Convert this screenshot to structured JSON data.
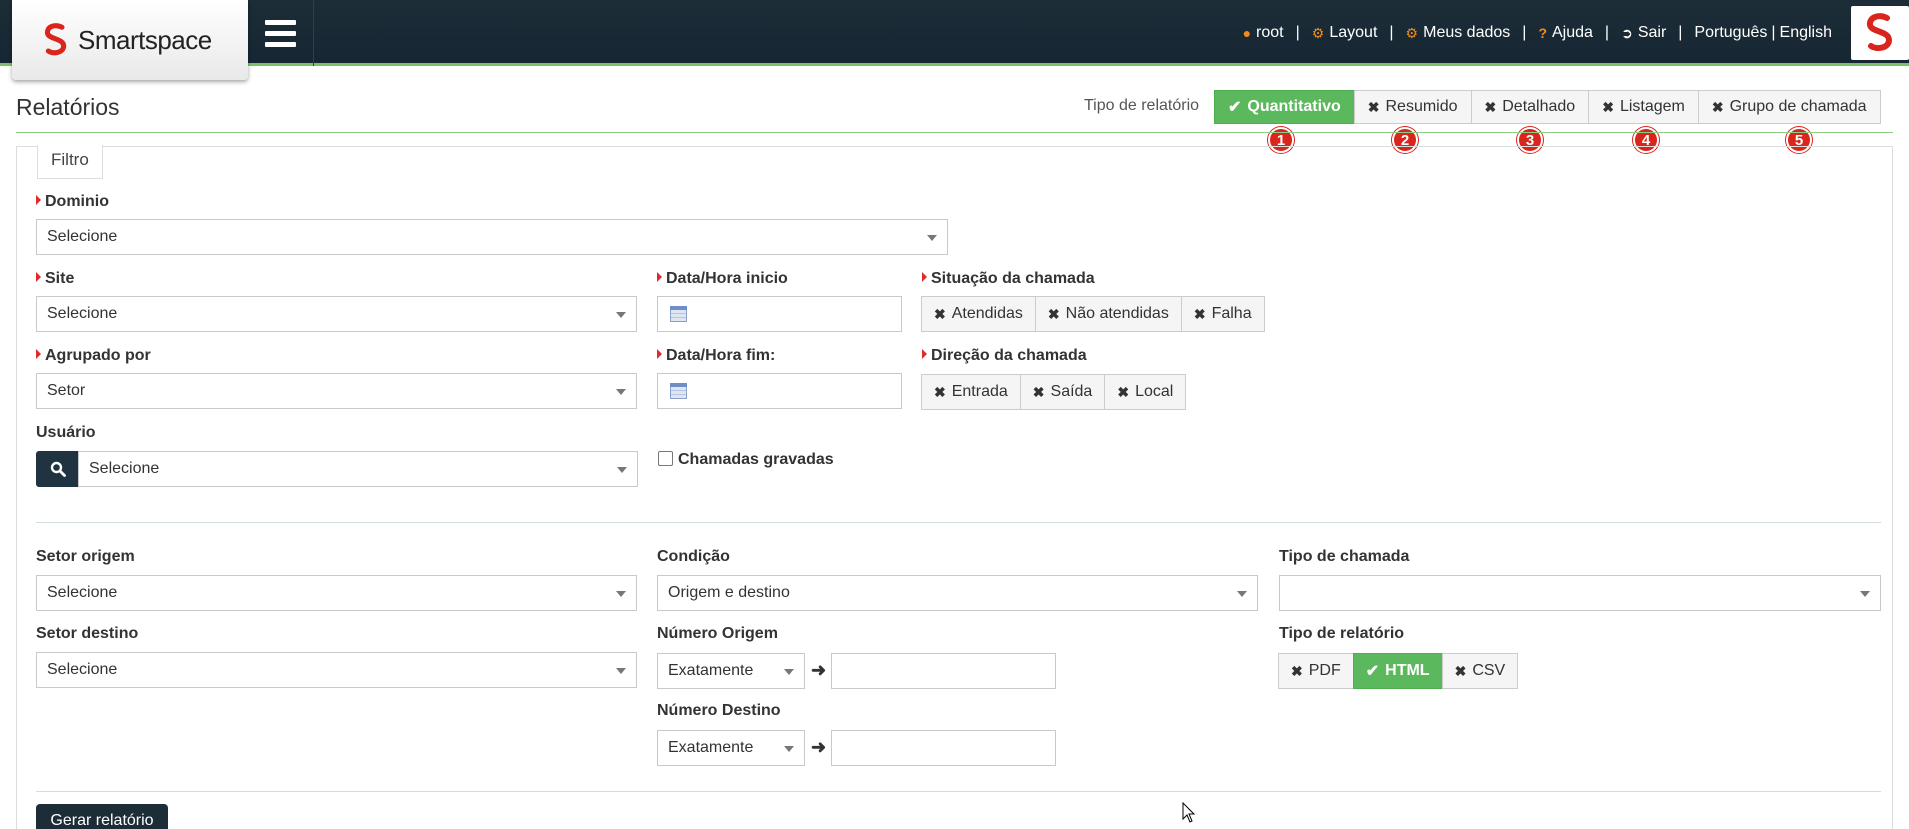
{
  "brand": {
    "name": "Smartspace"
  },
  "topnav": {
    "user": "root",
    "layout": "Layout",
    "my_data": "Meus dados",
    "help": "Ajuda",
    "logout": "Sair",
    "lang_pt": "Português",
    "lang_en": "English",
    "separator": "|"
  },
  "page": {
    "title": "Relatórios"
  },
  "report_type": {
    "label": "Tipo de relatório",
    "options": [
      {
        "label": "Quantitativo",
        "active": true,
        "badge": "1"
      },
      {
        "label": "Resumido",
        "active": false,
        "badge": "2"
      },
      {
        "label": "Detalhado",
        "active": false,
        "badge": "3"
      },
      {
        "label": "Listagem",
        "active": false,
        "badge": "4"
      },
      {
        "label": "Grupo de chamada",
        "active": false,
        "badge": "5"
      }
    ]
  },
  "filter": {
    "legend": "Filtro",
    "domain": {
      "label": "Dominio",
      "value": "Selecione"
    },
    "site": {
      "label": "Site",
      "value": "Selecione"
    },
    "grouped_by": {
      "label": "Agrupado por",
      "value": "Setor"
    },
    "user": {
      "label": "Usuário",
      "value": "Selecione"
    },
    "start": {
      "label": "Data/Hora inicio"
    },
    "end": {
      "label": "Data/Hora fim:"
    },
    "recorded": {
      "label": "Chamadas gravadas"
    },
    "call_status": {
      "label": "Situação da chamada",
      "options": [
        "Atendidas",
        "Não atendidas",
        "Falha"
      ]
    },
    "call_direction": {
      "label": "Direção da chamada",
      "options": [
        "Entrada",
        "Saída",
        "Local"
      ]
    },
    "origin_sector": {
      "label": "Setor origem",
      "value": "Selecione"
    },
    "dest_sector": {
      "label": "Setor destino",
      "value": "Selecione"
    },
    "condition": {
      "label": "Condição",
      "value": "Origem e destino"
    },
    "origin_number": {
      "label": "Número Origem",
      "mode": "Exatamente",
      "value": ""
    },
    "dest_number": {
      "label": "Número Destino",
      "mode": "Exatamente",
      "value": ""
    },
    "call_type": {
      "label": "Tipo de chamada",
      "value": ""
    },
    "output_type": {
      "label": "Tipo de relatório",
      "options": [
        {
          "label": "PDF",
          "active": false
        },
        {
          "label": "HTML",
          "active": true
        },
        {
          "label": "CSV",
          "active": false
        }
      ]
    },
    "generate": "Gerar relatório"
  }
}
